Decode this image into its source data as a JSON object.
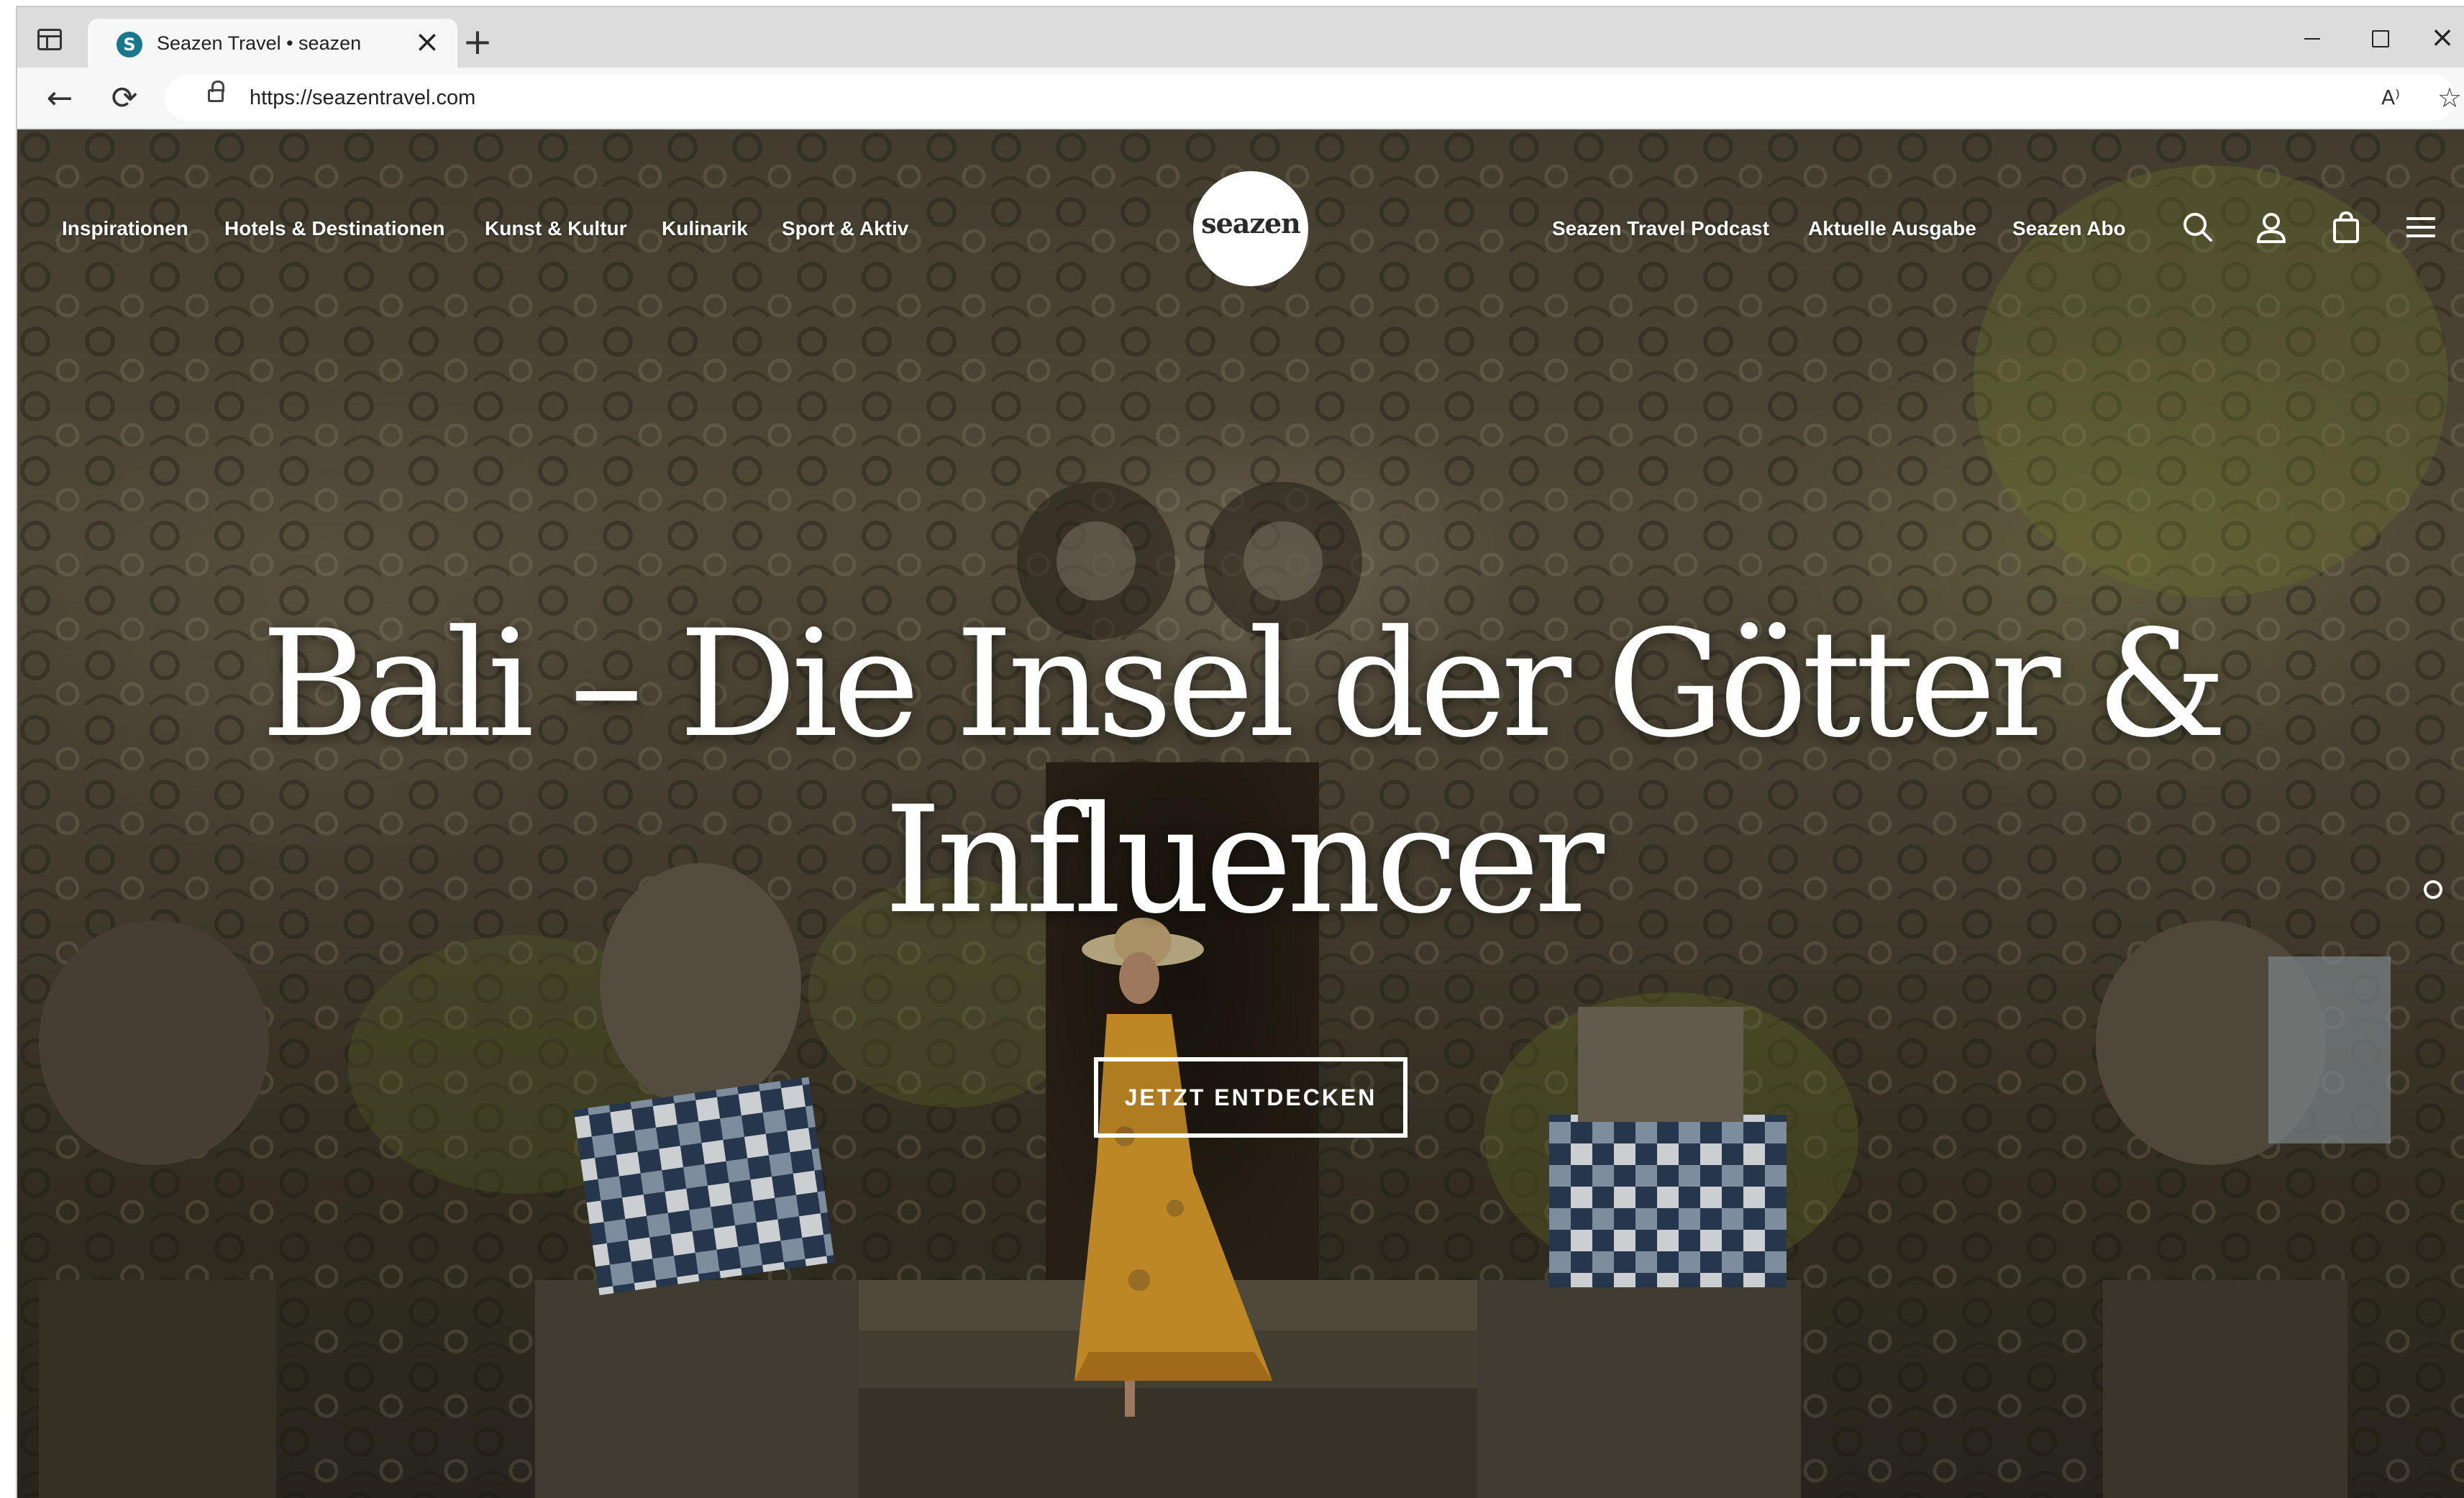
{
  "browser": {
    "tab_title": "Seazen Travel • seazen",
    "favicon_letter": "S",
    "tab_close": "×",
    "new_tab": "+",
    "window_close": "×",
    "url": "https://seazentravel.com",
    "back": "←",
    "reload": "⟳",
    "read_aloud": "A⁾",
    "favorite": "☆"
  },
  "site": {
    "logo": "seazen",
    "nav_left": [
      "Inspirationen",
      "Hotels & Destinationen",
      "Kunst & Kultur",
      "Kulinarik",
      "Sport & Aktiv"
    ],
    "nav_right": [
      "Seazen Travel Podcast",
      "Aktuelle Ausgabe",
      "Seazen Abo"
    ],
    "icons": [
      "search-icon",
      "account-icon",
      "shopping-bag-icon",
      "menu-icon"
    ]
  },
  "hero": {
    "headline_line1": "Bali – Die Insel der Götter &",
    "headline_line2": "Influencer",
    "cta_label": "JETZT ENTDECKEN"
  },
  "colors": {
    "accent_favicon": "#16788a",
    "hero_text": "#ffffff",
    "dress": "#d99a2b"
  }
}
